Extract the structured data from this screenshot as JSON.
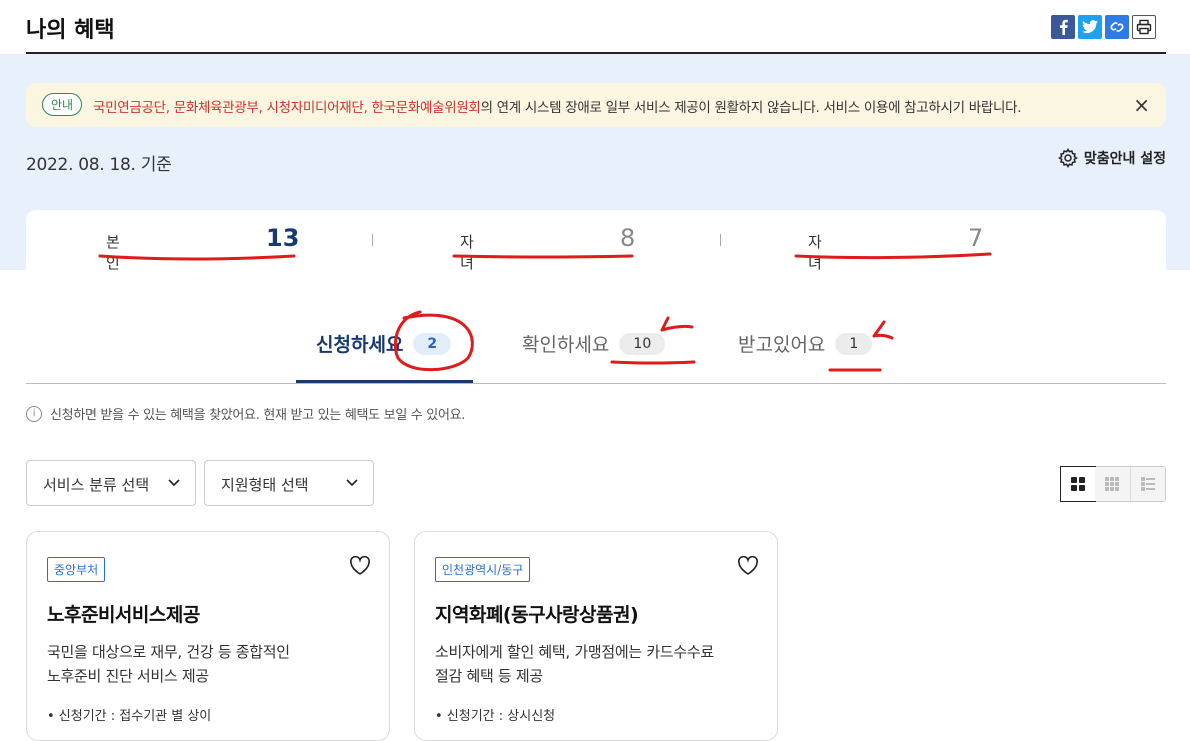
{
  "header": {
    "title": "나의 혜택"
  },
  "share": {
    "facebook": "facebook-icon",
    "twitter": "twitter-icon",
    "link": "link-icon",
    "print": "print-icon"
  },
  "notice": {
    "badge": "안내",
    "highlight": "국민연금공단, 문화체육관광부, 시청자미디어재단, 한국문화예술위원회",
    "text": "의 연계 시스템 장애로 일부 서비스 제공이 원활하지 않습니다. 서비스 이용에 참고하시기 바랍니다.",
    "close": "×"
  },
  "date": "2022. 08. 18. 기준",
  "settings_label": "맞춤안내 설정",
  "counts": [
    {
      "label": "본인",
      "value": "13",
      "color": "#183a72"
    },
    {
      "label": "자녀",
      "value": "8",
      "color": "#888888"
    },
    {
      "label": "자녀",
      "value": "7",
      "color": "#888888"
    }
  ],
  "tabs": [
    {
      "label": "신청하세요",
      "count": "2",
      "active": true
    },
    {
      "label": "확인하세요",
      "count": "10",
      "active": false
    },
    {
      "label": "받고있어요",
      "count": "1",
      "active": false
    }
  ],
  "info_text": "신청하면 받을 수 있는 혜택을 찾았어요. 현재 받고 있는 혜택도 보일 수 있어요.",
  "filters": {
    "category": "서비스 분류 선택",
    "support_type": "지원형태 선택"
  },
  "cards": [
    {
      "tag": "중앙부처",
      "title": "노후준비서비스제공",
      "desc": "국민을 대상으로 재무, 건강 등 종합적인\n노후준비 진단 서비스 제공",
      "meta": "•  신청기간 : 접수기관 별 상이"
    },
    {
      "tag": "인천광역시/동구",
      "title": "지역화폐(동구사랑상품권)",
      "desc": "소비자에게 할인 혜택, 가맹점에는 카드수수료\n절감 혜택 등 제공",
      "meta": "•  신청기간 : 상시신청"
    }
  ],
  "colors": {
    "accent": "#183a72",
    "annotation": "#e01b1b",
    "band": "#e8f0fb"
  }
}
